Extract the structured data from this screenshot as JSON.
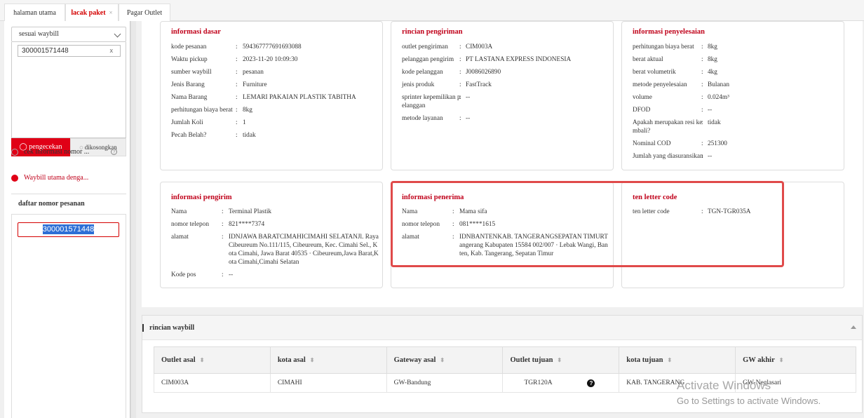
{
  "tabs": [
    {
      "label": "halaman utama"
    },
    {
      "label": "lacak paket",
      "close": "×"
    },
    {
      "label": "Pagar Outlet"
    }
  ],
  "search": {
    "mode": "sesuai waybill",
    "tag_value": "300001571448",
    "tag_close": "x",
    "search_button": "pengecekan",
    "clear_button": "dikosongkan",
    "option1": "cek informasi nomor ...",
    "option2": "Waybill utama denga..."
  },
  "order_list": {
    "title": "daftar nomor pesanan",
    "items": [
      "300001571448"
    ]
  },
  "basic_info": {
    "title": "informasi dasar",
    "rows": [
      {
        "k": "kode pesanan",
        "v": "594367777691693088"
      },
      {
        "k": "Waktu pickup",
        "v": "2023-11-20 10:09:30"
      },
      {
        "k": "sumber waybill",
        "v": "pesanan"
      },
      {
        "k": "Jenis Barang",
        "v": "Furniture"
      },
      {
        "k": "Nama Barang",
        "v": "LEMARI PAKAIAN PLASTIK TABITHA"
      },
      {
        "k": "perhitungan biaya berat",
        "v": "8kg"
      },
      {
        "k": "Jumlah Koli",
        "v": "1"
      },
      {
        "k": "Pecah Belah?",
        "v": "tidak"
      }
    ]
  },
  "shipping_details": {
    "title": "rincian pengiriman",
    "rows": [
      {
        "k": "outlet pengiriman",
        "v": "CIM003A"
      },
      {
        "k": "pelanggan pengirim",
        "v": "PT LASTANA EXPRESS INDONESIA"
      },
      {
        "k": "kode pelanggan",
        "v": "J0086026890"
      },
      {
        "k": "jenis produk",
        "v": "FastTrack"
      },
      {
        "k": "sprinter kepemilikan p",
        "k2": "elanggan",
        "v": "--"
      },
      {
        "k": "metode layanan",
        "v": "--"
      }
    ]
  },
  "settlement_info": {
    "title": "informasi penyelesaian",
    "rows": [
      {
        "k": "perhitungan biaya berat",
        "v": "8kg"
      },
      {
        "k": "berat aktual",
        "v": "8kg"
      },
      {
        "k": "berat volumetrik",
        "v": "4kg"
      },
      {
        "k": "metode penyelesaian",
        "v": "Bulanan"
      },
      {
        "k": "volume",
        "v": "0.024m³"
      },
      {
        "k": "DFOD",
        "v": "--"
      },
      {
        "k": "Apakah merupakan resi ke",
        "k2": "mbali?",
        "v": "tidak"
      },
      {
        "k": "Nominal COD",
        "v": "251300"
      },
      {
        "k": "Jumlah yang diasuransikan",
        "v": "--"
      }
    ]
  },
  "sender_info": {
    "title": "informasi pengirim",
    "name_k": "Nama",
    "name_v": "Terminal Plastik",
    "phone_k": "nomor telepon",
    "phone_v": "821****7374",
    "addr_k": "alamat",
    "addr_l1": "IDNJAWA BARATCIMAHICIMAHI SELATANJl. Raya",
    "addr_l2": "Cibeureum No.111/115, Cibeureum, Kec. Cimahi Sel., K",
    "addr_l3": "ota Cimahi, Jawa Barat 40535 · Cibeureum,Jawa Barat,K",
    "addr_l4": "ota Cimahi,Cimahi Selatan",
    "post_k": "Kode pos",
    "post_v": "--"
  },
  "receiver_info": {
    "title": "informasi penerima",
    "name_k": "Nama",
    "name_v": "Mama sifa",
    "phone_k": "nomor telepon",
    "phone_v": "081****1615",
    "addr_k": "alamat",
    "addr_l1": "IDNBANTENKAB. TANGERANGSEPATAN TIMURT",
    "addr_l2": "angerang Kabupaten 15584 002/007 · Lebak Wangi, Ban",
    "addr_l3": "ten, Kab. Tangerang, Sepatan Timur"
  },
  "ten_letter": {
    "title": "ten letter code",
    "k": "ten letter code",
    "v": "TGN-TGR035A"
  },
  "colon": ":",
  "waybill_details": {
    "title": "rincian waybill",
    "headers": [
      "Outlet asal",
      "kota asal",
      "Gateway asal",
      "Outlet tujuan",
      "kota tujuan",
      "GW akhir"
    ],
    "row": [
      "CIM003A",
      "CIMAHI",
      "GW-Bandung",
      "TGR120A",
      "KAB. TANGERANG",
      "GW-Neglasari"
    ],
    "help": "?"
  },
  "activation": {
    "line1": "Activate Windows",
    "line2": "Go to Settings to activate Windows."
  },
  "colors": {
    "accent": "#e00016",
    "title_red": "#c0001a",
    "highlight": "#e04a4a"
  }
}
